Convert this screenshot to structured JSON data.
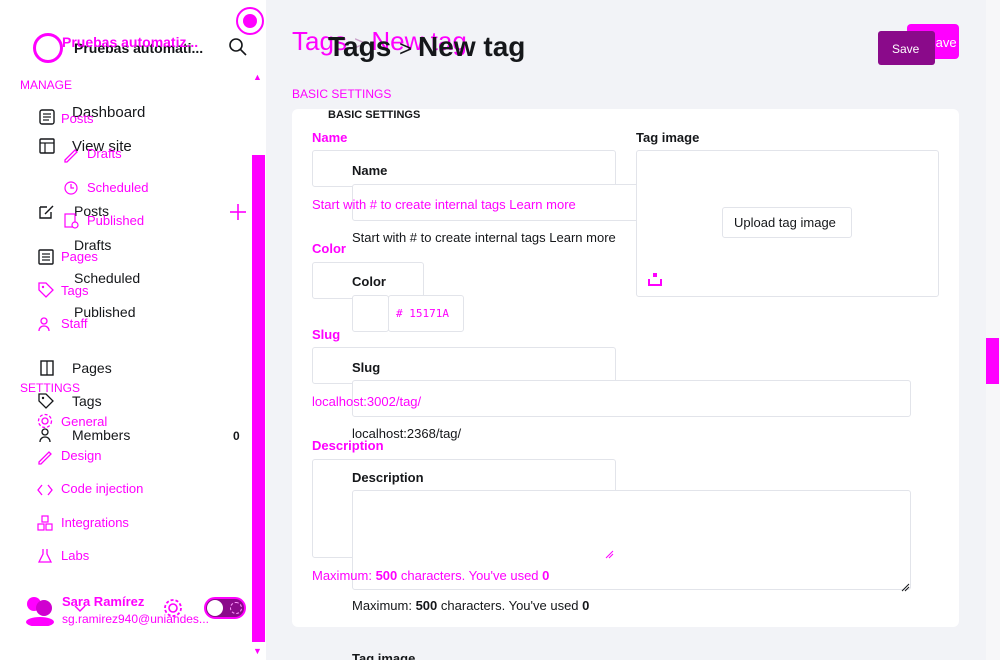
{
  "site": {
    "name": "Pruebas automatiz...",
    "name_shadow": "Pruebas automati..."
  },
  "sidebar": {
    "manage_heading": "MANAGE",
    "settings_heading": "SETTINGS",
    "items_overlay": {
      "posts": "Posts",
      "drafts": "Drafts",
      "scheduled": "Scheduled",
      "published": "Published",
      "pages": "Pages",
      "tags": "Tags",
      "staff": "Staff",
      "general": "General",
      "design": "Design",
      "code_injection": "Code injection",
      "integrations": "Integrations",
      "labs": "Labs"
    },
    "items_base": {
      "dashboard": "Dashboard",
      "view_site": "View site",
      "posts": "Posts",
      "drafts": "Drafts",
      "scheduled": "Scheduled",
      "published": "Published",
      "pages": "Pages",
      "tags": "Tags",
      "members": "Members",
      "members_count": "0"
    },
    "user": {
      "name": "Sara Ramírez",
      "email": "sg.ramirez940@uniandes..."
    }
  },
  "header": {
    "breadcrumb_parent": "Tags",
    "breadcrumb_current": "New tag",
    "breadcrumb_parent_overlay": "Tags",
    "breadcrumb_current_overlay": "New tag",
    "save_label": "Save",
    "save_label_overlay": "Save"
  },
  "form": {
    "section_title": "BASIC SETTINGS",
    "section_title_overlay": "BASIC SETTINGS",
    "name_label": "Name",
    "name_hint": "Start with # to create internal tags",
    "learn_more": "Learn more",
    "color_label": "Color",
    "color_value": "15171A",
    "color_prefix": "#",
    "slug_label": "Slug",
    "slug_preview_overlay": "localhost:3002/tag/",
    "slug_preview": "localhost:2368/tag/",
    "description_label": "Description",
    "description_hint_prefix": "Maximum:",
    "description_max": "500",
    "description_hint_mid": "characters. You've used",
    "description_used": "0",
    "tag_image_label": "Tag image",
    "upload_label": "Upload tag image"
  },
  "colors": {
    "accent": "#ff00ff",
    "dark_accent": "#8a0a8a",
    "text": "#15171a",
    "bg": "#f2f3f7"
  }
}
